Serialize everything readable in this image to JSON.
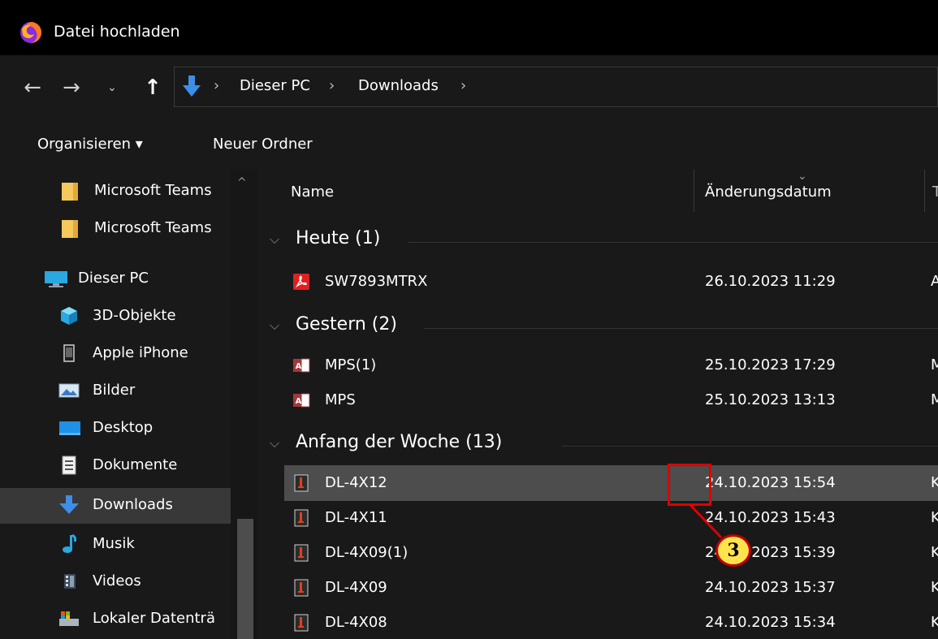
{
  "window": {
    "title": "Datei hochladen",
    "app_icon": "firefox-icon"
  },
  "nav": {
    "back_icon": "back-arrow-icon",
    "forward_icon": "forward-arrow-icon",
    "recent_icon": "chevron-down-icon",
    "up_icon": "up-arrow-icon"
  },
  "breadcrumb": {
    "items": [
      "Dieser PC",
      "Downloads"
    ],
    "separator": "›"
  },
  "toolbar": {
    "organize": "Organisieren ▾",
    "new_folder": "Neuer Ordner"
  },
  "navpane": {
    "items": [
      {
        "label": "Microsoft Teams",
        "icon": "folder-icon"
      },
      {
        "label": "Microsoft Teams",
        "icon": "folder-icon"
      },
      {
        "label": "Dieser PC",
        "icon": "computer-icon"
      },
      {
        "label": "3D-Objekte",
        "icon": "cube-icon"
      },
      {
        "label": "Apple iPhone",
        "icon": "phone-icon"
      },
      {
        "label": "Bilder",
        "icon": "pictures-icon"
      },
      {
        "label": "Desktop",
        "icon": "desktop-icon"
      },
      {
        "label": "Dokumente",
        "icon": "document-icon"
      },
      {
        "label": "Downloads",
        "icon": "download-icon"
      },
      {
        "label": "Musik",
        "icon": "music-icon"
      },
      {
        "label": "Videos",
        "icon": "video-icon"
      },
      {
        "label": "Lokaler Datenträ",
        "icon": "drive-icon"
      }
    ],
    "selected": "Downloads"
  },
  "columns": {
    "name": "Name",
    "date": "Änderungsdatum",
    "type": "T"
  },
  "groups": [
    {
      "title": "Heute (1)",
      "files": [
        {
          "name": "SW7893MTRX",
          "date": "26.10.2023 11:29",
          "type": "A",
          "icon": "pdf-icon"
        }
      ]
    },
    {
      "title": "Gestern (2)",
      "files": [
        {
          "name": "MPS(1)",
          "date": "25.10.2023 17:29",
          "type": "M",
          "icon": "access-db-icon"
        },
        {
          "name": "MPS",
          "date": "25.10.2023 13:13",
          "type": "M",
          "icon": "access-db-icon"
        }
      ]
    },
    {
      "title": "Anfang der Woche (13)",
      "files": [
        {
          "name": "DL-4X12",
          "date": "24.10.2023 15:54",
          "type": "K",
          "icon": "file-icon",
          "selected": true
        },
        {
          "name": "DL-4X11",
          "date": "24.10.2023 15:43",
          "type": "K",
          "icon": "file-icon"
        },
        {
          "name": "DL-4X09(1)",
          "date": "24.10.2023 15:39",
          "type": "K",
          "icon": "file-icon"
        },
        {
          "name": "DL-4X09",
          "date": "24.10.2023 15:37",
          "type": "K",
          "icon": "file-icon"
        },
        {
          "name": "DL-4X08",
          "date": "24.10.2023 15:34",
          "type": "K",
          "icon": "file-icon"
        }
      ]
    }
  ],
  "callout": {
    "number": "3",
    "color": "#e00000",
    "badge_color": "#ffe34d"
  }
}
